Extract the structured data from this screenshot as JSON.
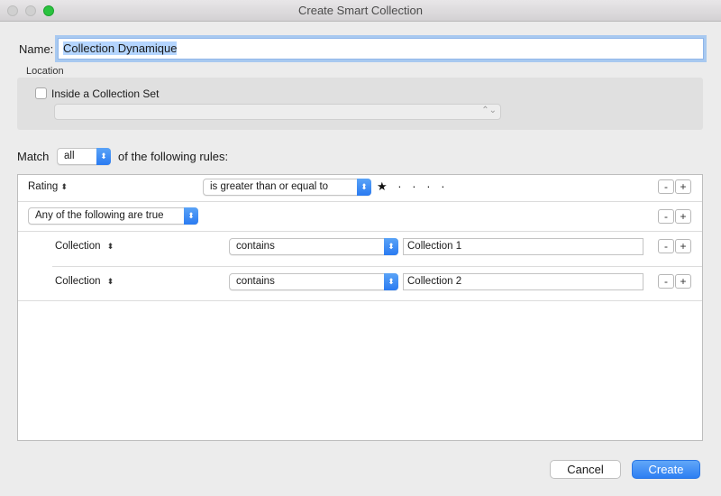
{
  "window": {
    "title": "Create Smart Collection"
  },
  "name_label": "Name:",
  "name_value": "Collection Dynamique",
  "location": {
    "label": "Location",
    "checkbox_label": "Inside a Collection Set",
    "checked": false
  },
  "match": {
    "prefix": "Match",
    "selected": "all",
    "suffix": "of the following rules:"
  },
  "rules": [
    {
      "field": "Rating",
      "operator": "is greater than or equal to",
      "value_stars": 1,
      "max_stars": 5
    },
    {
      "group": "Any of the following are true"
    },
    {
      "field": "Collection",
      "operator": "contains",
      "value": "Collection 1"
    },
    {
      "field": "Collection",
      "operator": "contains",
      "value": "Collection 2"
    }
  ],
  "buttons": {
    "minus": "-",
    "plus": "+",
    "cancel": "Cancel",
    "create": "Create"
  },
  "icons": {
    "updown": "⬍",
    "star": "★",
    "dot": "·",
    "select_arrows": "⌃⌄"
  },
  "colors": {
    "accent": "#2d7ef2",
    "selection": "#b4d5fe"
  }
}
